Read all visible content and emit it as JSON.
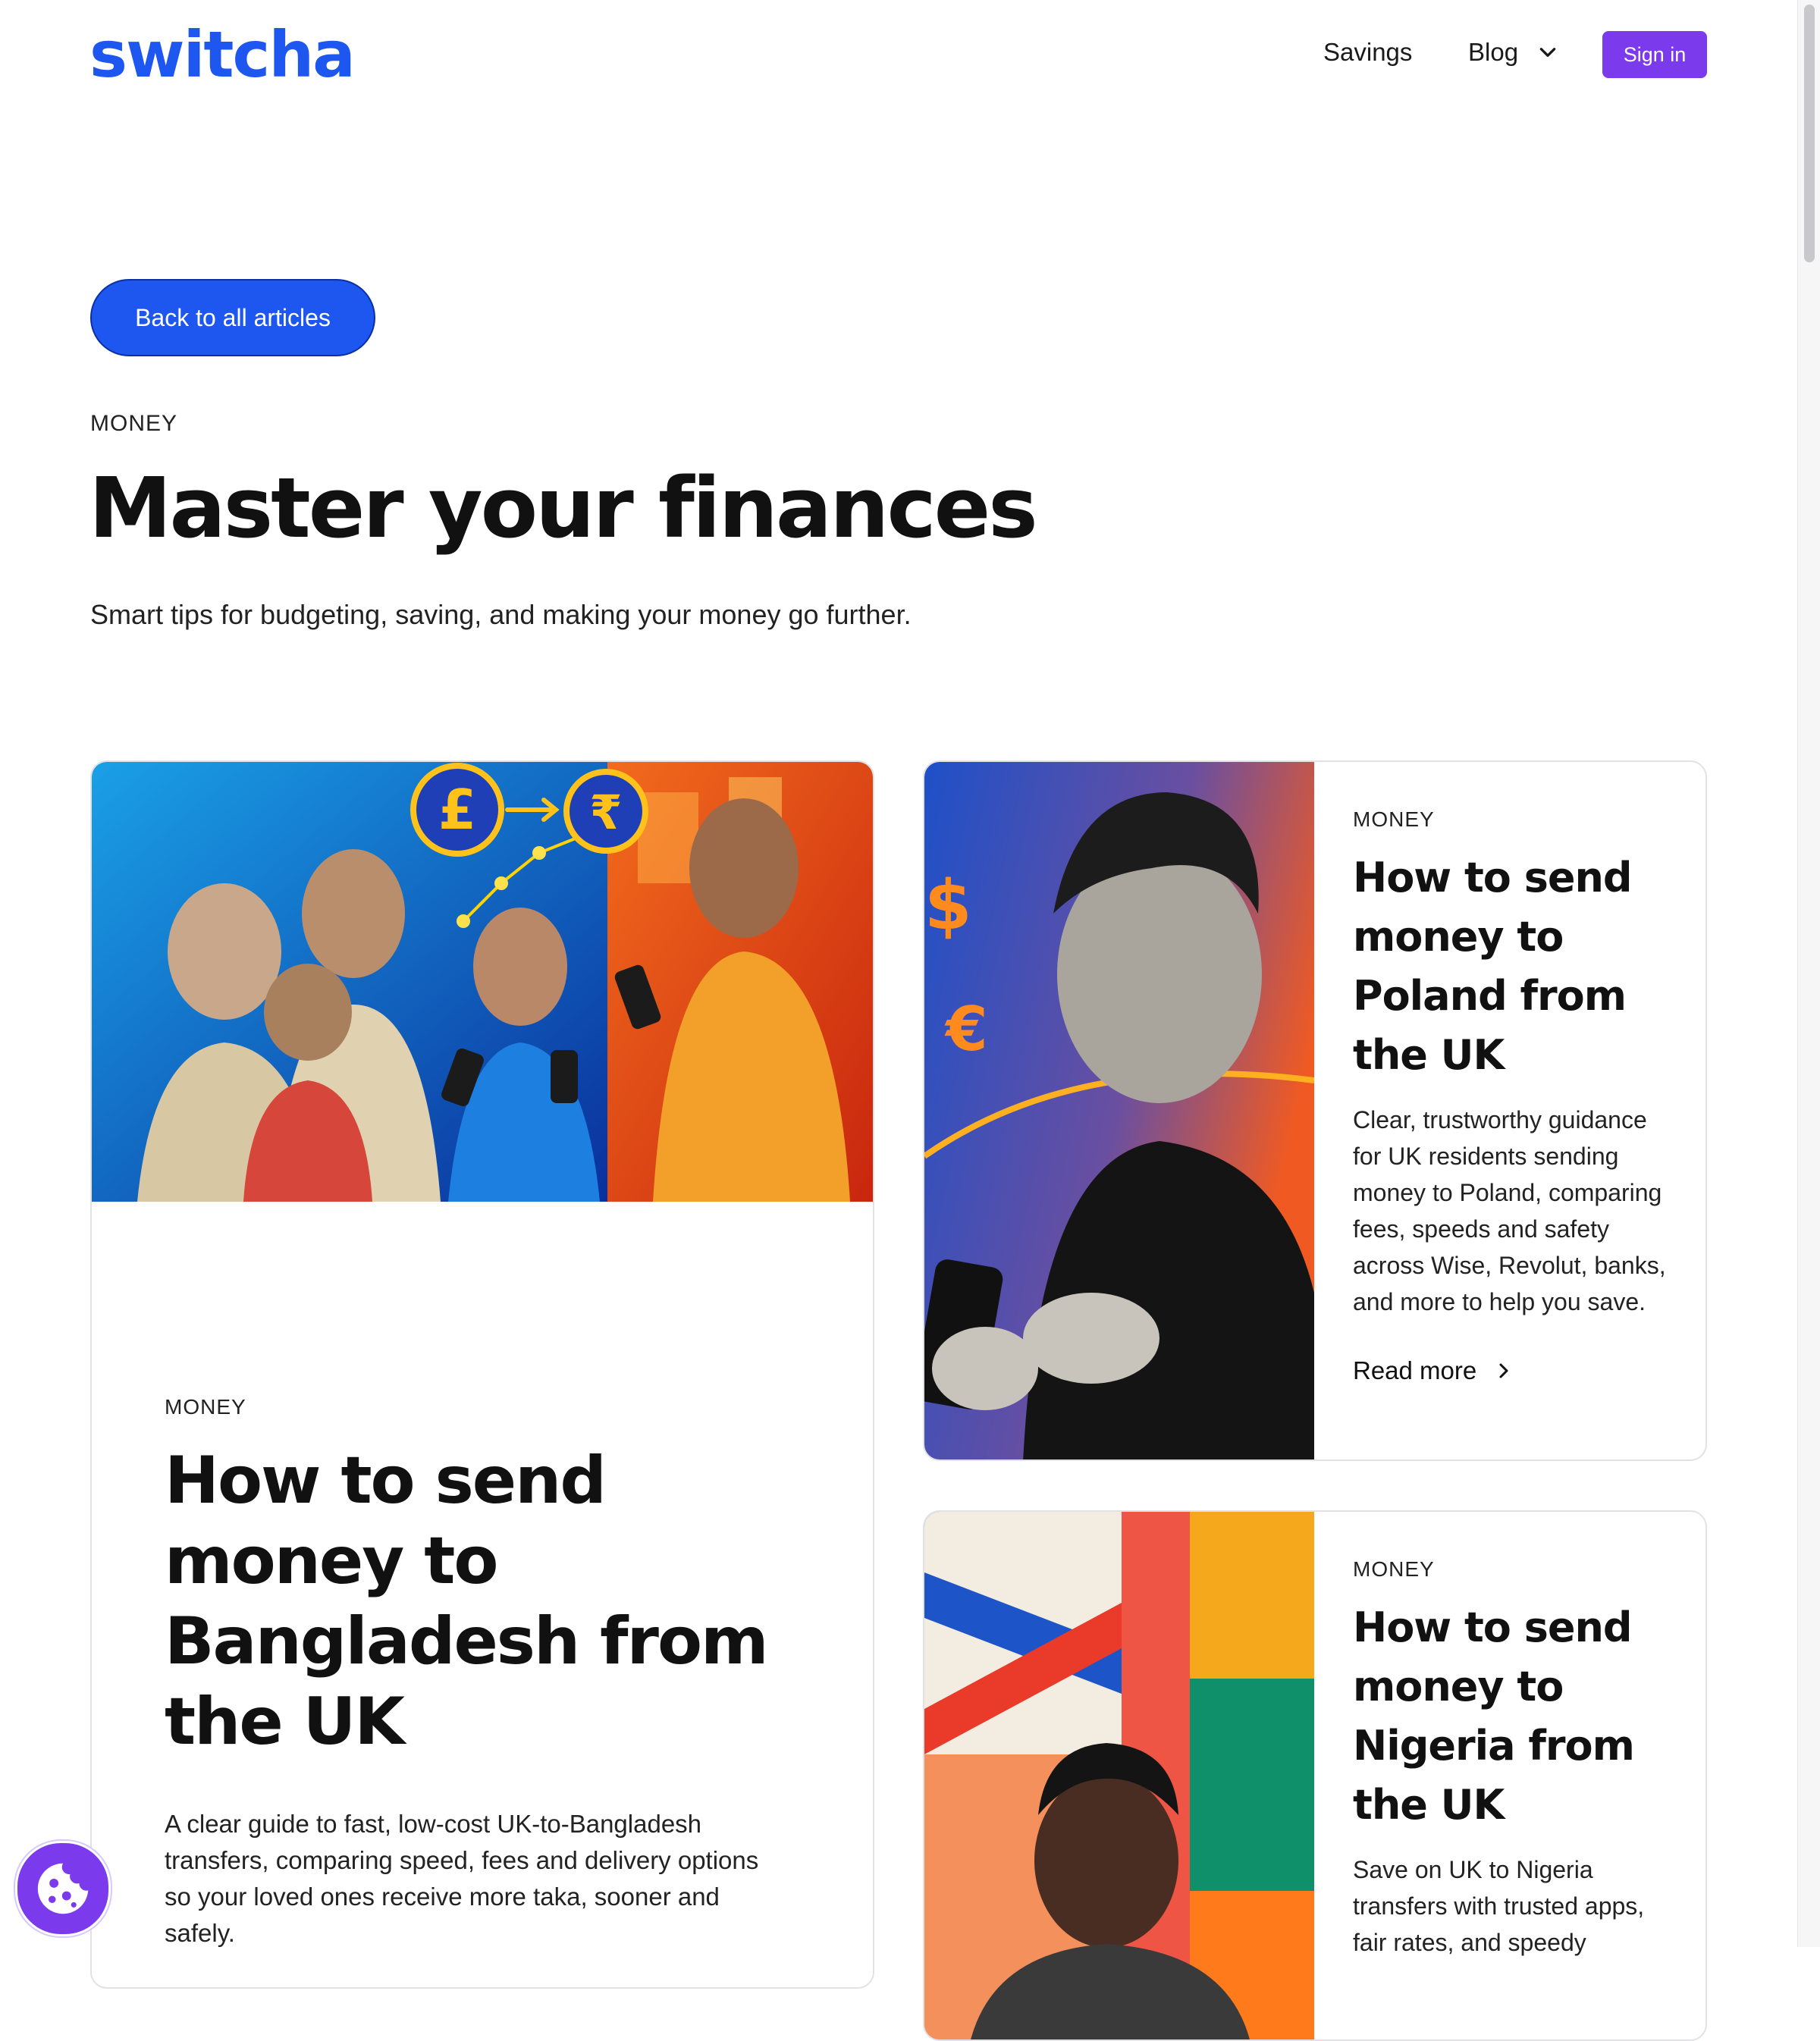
{
  "header": {
    "logo": "switcha",
    "nav": {
      "savings": "Savings",
      "blog": "Blog"
    },
    "sign_in": "Sign in"
  },
  "hero": {
    "back_button": "Back to all articles",
    "eyebrow": "MONEY",
    "title": "Master your finances",
    "subtitle": "Smart tips for budgeting, saving, and making your money go further."
  },
  "articles": [
    {
      "category": "MONEY",
      "title": "How to send money to Bangladesh from the UK",
      "description": "A clear guide to fast, low-cost UK-to-Bangladesh transfers, comparing speed, fees and delivery options so your loved ones receive more taka, sooner and safely.",
      "image_icons": [
        "pound-coin-icon",
        "rupee-coin-icon"
      ],
      "image_text": {
        "pound": "£",
        "taka": "₹"
      }
    },
    {
      "category": "MONEY",
      "title": "How to send money to Poland from the UK",
      "description": "Clear, trustworthy guidance for UK residents sending money to Poland, comparing fees, speeds and safety across Wise, Revolut, banks, and more to help you save.",
      "read_more": "Read more",
      "image_text": {
        "dollar": "$",
        "euro": "€"
      }
    },
    {
      "category": "MONEY",
      "title": "How to send money to Nigeria from the UK",
      "description": "Save on UK to Nigeria transfers with trusted apps, fair rates, and speedy"
    }
  ],
  "colors": {
    "brand_blue": "#1d57f0",
    "purple": "#7c3aed",
    "text": "#111111"
  }
}
